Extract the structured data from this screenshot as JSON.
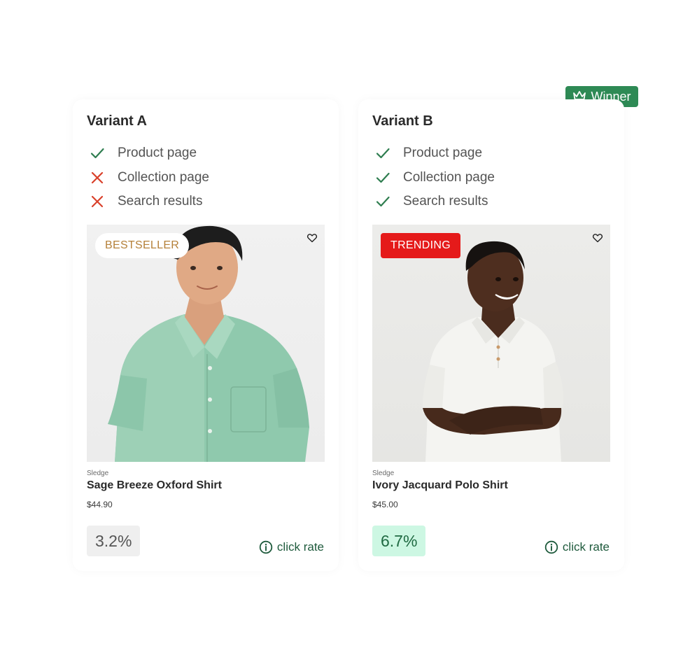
{
  "winner_badge": {
    "label": "Winner",
    "icon": "crown-icon",
    "color": "#2e8a55"
  },
  "variants": [
    {
      "title": "Variant A",
      "placements": [
        {
          "label": "Product page",
          "enabled": true
        },
        {
          "label": "Collection page",
          "enabled": false
        },
        {
          "label": "Search results",
          "enabled": false
        }
      ],
      "badge": "BESTSELLER",
      "vendor": "Sledge",
      "product_name": "Sage Breeze Oxford Shirt",
      "price": "$44.90",
      "click_rate": "3.2%",
      "click_rate_label": "click rate"
    },
    {
      "title": "Variant B",
      "placements": [
        {
          "label": "Product page",
          "enabled": true
        },
        {
          "label": "Collection page",
          "enabled": true
        },
        {
          "label": "Search results",
          "enabled": true
        }
      ],
      "badge": "TRENDING",
      "vendor": "Sledge",
      "product_name": "Ivory Jacquard Polo Shirt",
      "price": "$45.00",
      "click_rate": "6.7%",
      "click_rate_label": "click rate"
    }
  ],
  "colors": {
    "check": "#2e7d4f",
    "cross": "#d9412b",
    "trending_badge": "#e51a1a",
    "bestseller_text": "#b5813a",
    "winner_rate_bg": "#cdf7e3"
  }
}
